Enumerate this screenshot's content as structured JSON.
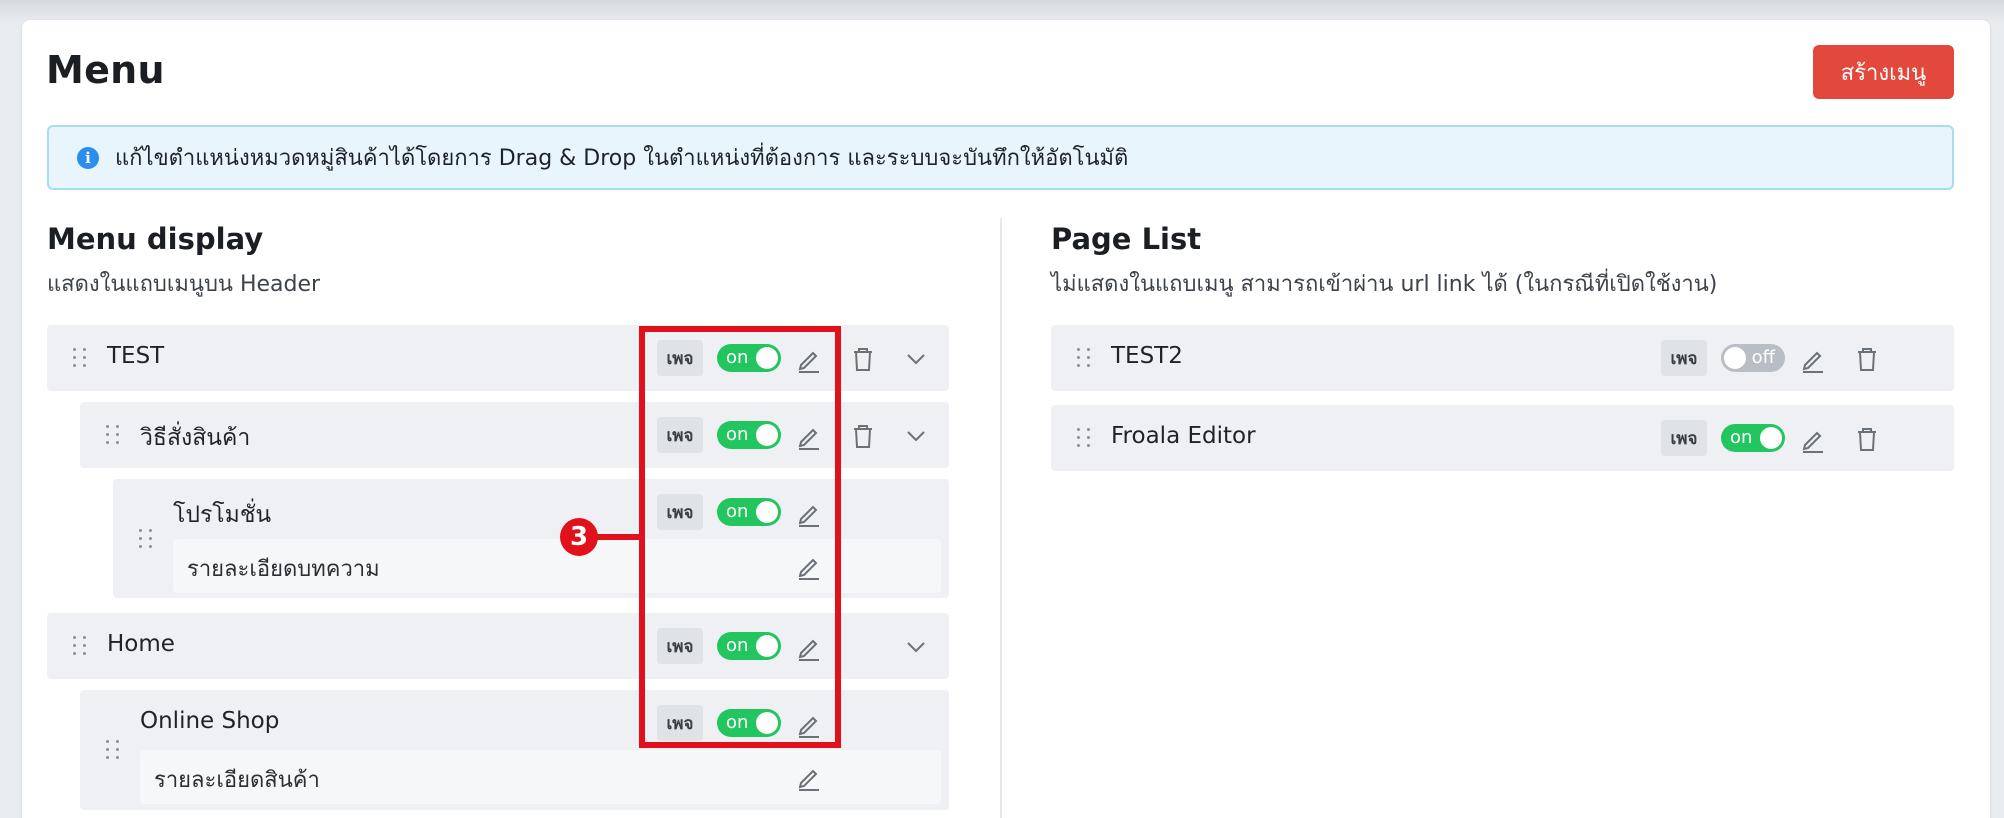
{
  "header": {
    "title": "Menu",
    "create_button": "สร้างเมนู"
  },
  "alert": {
    "icon": "info-icon",
    "text": "แก้ไขตำแหน่งหมวดหมู่สินค้าได้โดยการ Drag & Drop ในตำแหน่งที่ต้องการ และระบบจะบันทึกให้อัตโนมัติ"
  },
  "menu_display": {
    "title": "Menu display",
    "subtitle": "แสดงในแถบเมนูบน Header",
    "items": [
      {
        "label": "TEST",
        "badge": "เพจ",
        "toggle": "on"
      },
      {
        "label": "วิธีสั่งสินค้า",
        "badge": "เพจ",
        "toggle": "on"
      },
      {
        "label": "โปรโมชั่น",
        "badge": "เพจ",
        "toggle": "on",
        "sub_label": "รายละเอียดบทความ"
      },
      {
        "label": "Home",
        "badge": "เพจ",
        "toggle": "on"
      },
      {
        "label": "Online Shop",
        "badge": "เพจ",
        "toggle": "on",
        "sub_label": "รายละเอียดสินค้า"
      }
    ]
  },
  "page_list": {
    "title": "Page List",
    "subtitle": "ไม่แสดงในแถบเมนู สามารถเข้าผ่าน url link ได้ (ในกรณีที่เปิดใช้งาน)",
    "items": [
      {
        "label": "TEST2",
        "badge": "เพจ",
        "toggle": "off"
      },
      {
        "label": "Froala Editor",
        "badge": "เพจ",
        "toggle": "on"
      }
    ]
  },
  "annotation": {
    "callout_number": "3",
    "color": "#e0111a"
  },
  "colors": {
    "accent": "#e2493c",
    "toggle_on": "#22c55e",
    "toggle_off": "#b9bec5",
    "info": "#2d8cf0"
  }
}
